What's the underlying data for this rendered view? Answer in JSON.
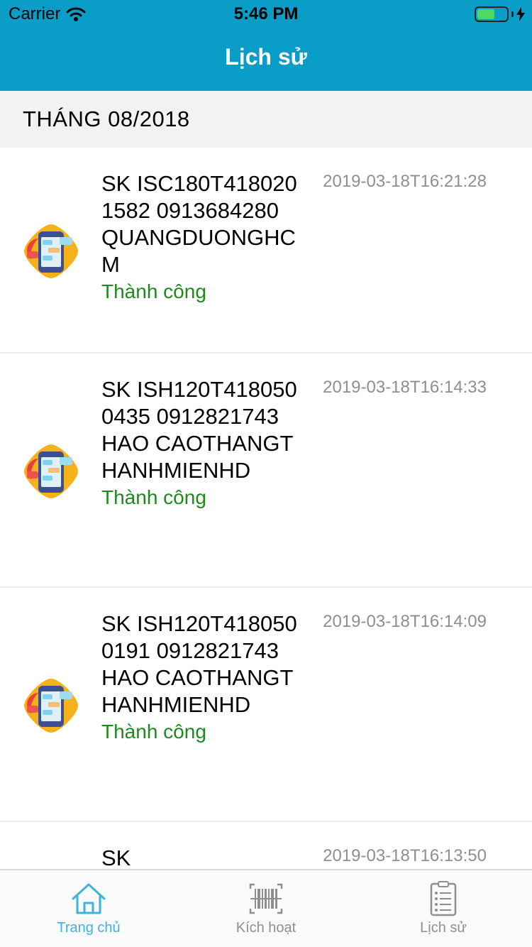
{
  "status_bar": {
    "carrier": "Carrier",
    "time": "5:46 PM",
    "battery_level": 0.6
  },
  "nav": {
    "title": "Lịch sử"
  },
  "section": {
    "title": "THÁNG 08/2018"
  },
  "items": [
    {
      "text": "SK ISC180T4180201582 0913684280 QUANGDUONGHCM",
      "status": "Thành công",
      "time": "2019-03-18T16:21:28"
    },
    {
      "text": "SK ISH120T4180500435 0912821743 HAO CAOTHANGTHANHMIENHD",
      "status": "Thành công",
      "time": "2019-03-18T16:14:33"
    },
    {
      "text": "SK ISH120T4180500191 0912821743 HAO CAOTHANGTHANHMIENHD",
      "status": "Thành công",
      "time": "2019-03-18T16:14:09"
    },
    {
      "text": "SK",
      "status": "",
      "time": "2019-03-18T16:13:50"
    }
  ],
  "tabs": [
    {
      "label": "Trang chủ",
      "icon": "home-icon",
      "active": true
    },
    {
      "label": "Kích hoạt",
      "icon": "barcode-icon",
      "active": false
    },
    {
      "label": "Lịch sử",
      "icon": "clipboard-list-icon",
      "active": false
    }
  ],
  "colors": {
    "header": "#0a9dc7",
    "success": "#1e8a1e",
    "tab_active": "#3cb4dc",
    "tab_inactive": "#8e8e93"
  }
}
